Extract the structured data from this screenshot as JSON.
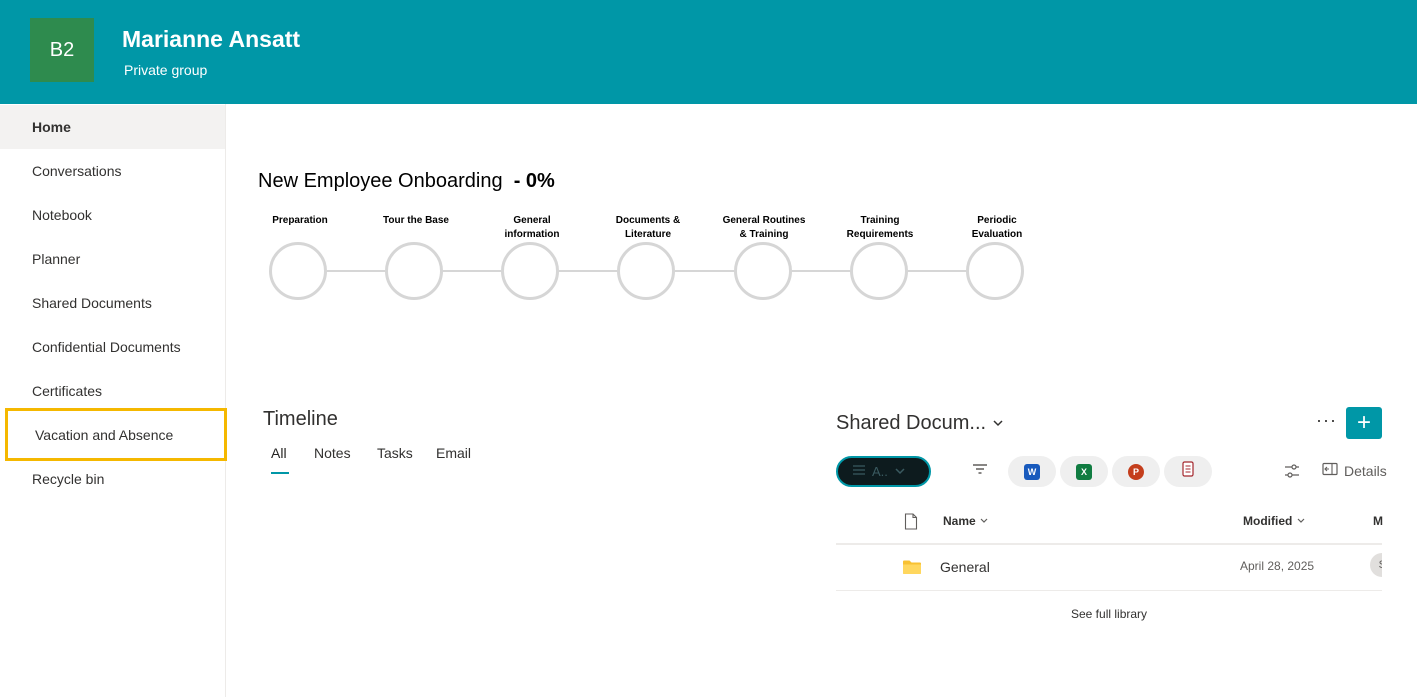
{
  "header": {
    "logo_text": "B2",
    "title": "Marianne Ansatt",
    "subtitle": "Private group",
    "brand_color": "#0097a7",
    "logo_color": "#2e8b4e"
  },
  "sidebar": {
    "items": [
      {
        "label": "Home"
      },
      {
        "label": "Conversations"
      },
      {
        "label": "Notebook"
      },
      {
        "label": "Planner"
      },
      {
        "label": "Shared Documents"
      },
      {
        "label": "Confidential Documents"
      },
      {
        "label": "Certificates"
      },
      {
        "label": "Vacation and Absence"
      },
      {
        "label": "Recycle bin"
      }
    ]
  },
  "onboarding": {
    "title": "New Employee Onboarding",
    "progress_text": "- 0%",
    "steps": [
      {
        "line1": "Preparation",
        "line2": ""
      },
      {
        "line1": "Tour the Base",
        "line2": ""
      },
      {
        "line1": "General",
        "line2": "information"
      },
      {
        "line1": "Documents &",
        "line2": "Literature"
      },
      {
        "line1": "General Routines",
        "line2": "& Training"
      },
      {
        "line1": "Training",
        "line2": "Requirements"
      },
      {
        "line1": "Periodic",
        "line2": "Evaluation"
      }
    ]
  },
  "timeline": {
    "title": "Timeline",
    "tabs": [
      "All",
      "Notes",
      "Tasks",
      "Email"
    ]
  },
  "shared_docs": {
    "title": "Shared Docum...",
    "more_label": "···",
    "add_label": "+",
    "view_label": "A..",
    "apps": [
      {
        "icon": "word-icon",
        "letter": "W",
        "color": "#185abd"
      },
      {
        "icon": "excel-icon",
        "letter": "X",
        "color": "#107c41"
      },
      {
        "icon": "powerpoint-icon",
        "letter": "P",
        "color": "#c43e1c"
      },
      {
        "icon": "forms-icon",
        "letter": "",
        "color": "#a4262c"
      }
    ],
    "details_label": "Details",
    "columns": {
      "name": "Name",
      "modified": "Modified",
      "modified_by": "M"
    },
    "rows": [
      {
        "name": "General",
        "modified": "April 28, 2025",
        "avatar": "S"
      }
    ],
    "see_full": "See full library"
  }
}
